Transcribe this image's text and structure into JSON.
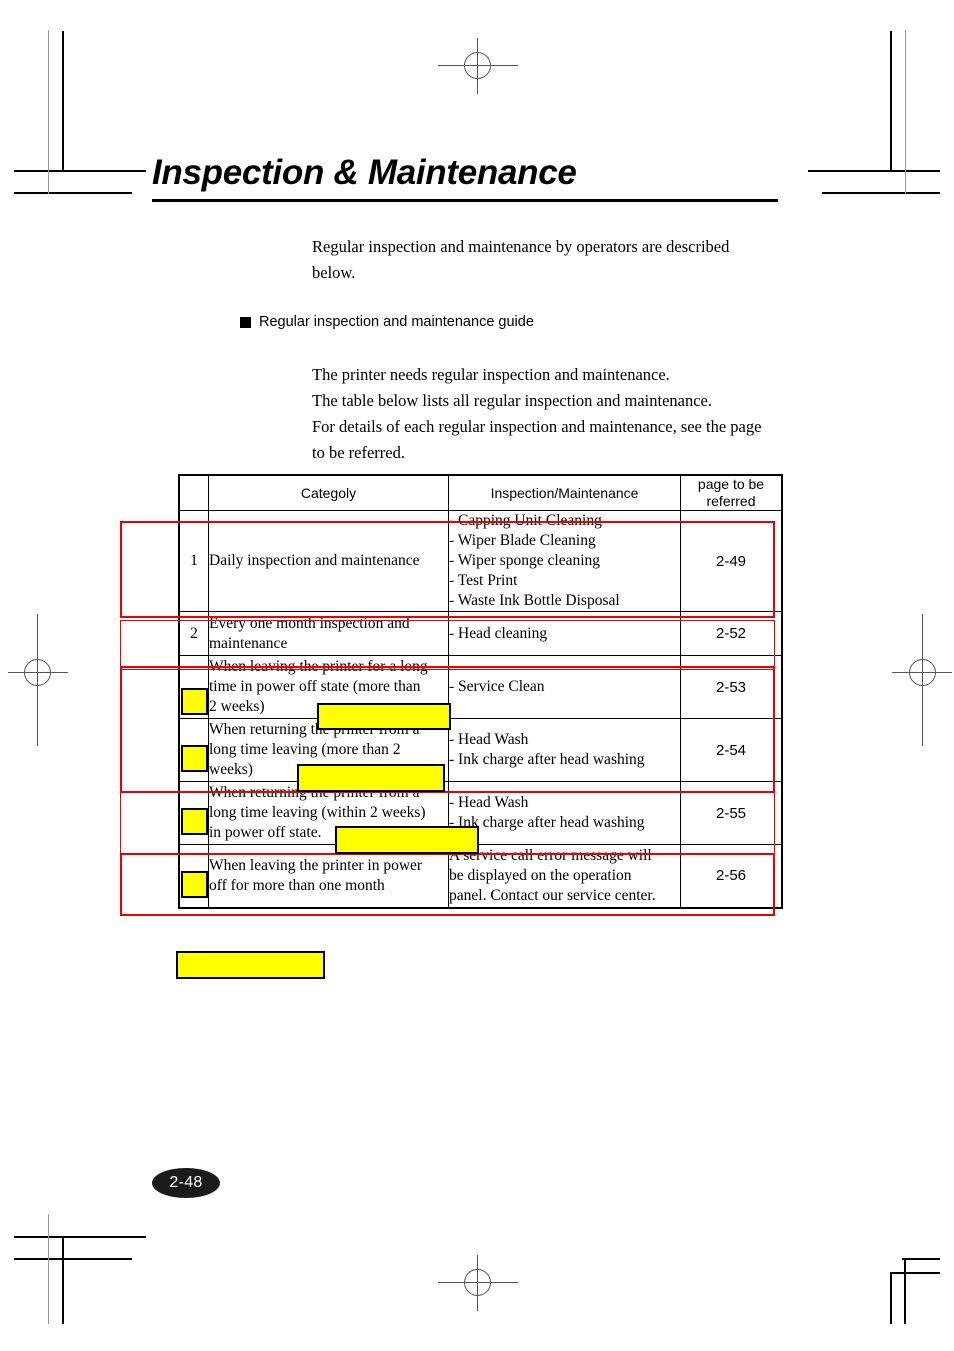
{
  "document": {
    "title": "Inspection & Maintenance",
    "page_number": "2-48"
  },
  "intro": {
    "line1": "Regular inspection and maintenance by operators are described",
    "line2": "below."
  },
  "section": {
    "bullet_heading": "Regular inspection and maintenance guide",
    "body": {
      "line1": "The printer needs regular inspection and maintenance.",
      "line2": "The table below lists all regular inspection and maintenance.",
      "line3": "For details of each regular inspection and maintenance, see the page",
      "line4": "to be referred."
    }
  },
  "table": {
    "headers": {
      "number": "",
      "category": "Categoly",
      "inspection": "Inspection/Maintenance",
      "page": "page to be referred",
      "page_line1": "page to be",
      "page_line2": "referred"
    },
    "rows": [
      {
        "number": "1",
        "category_lines": [
          "Daily inspection and maintenance"
        ],
        "inspection_lines": [
          "- Capping Unit Cleaning",
          "- Wiper Blade Cleaning",
          "- Wiper sponge cleaning",
          "- Test Print",
          "- Waste Ink Bottle Disposal"
        ],
        "page": "2-49"
      },
      {
        "number": "2",
        "category_lines": [
          "Every one month inspection and",
          "maintenance"
        ],
        "inspection_lines": [
          "- Head cleaning"
        ],
        "page": "2-52"
      },
      {
        "number": "",
        "category_lines": [
          "When leaving the printer for a long",
          "time in power off state (more than",
          "2 weeks)"
        ],
        "inspection_lines": [
          "- Service Clean"
        ],
        "page": "2-53"
      },
      {
        "number": "",
        "category_lines": [
          "When returning the printer from a",
          "long time leaving (more than 2",
          "weeks)"
        ],
        "inspection_lines": [
          "- Head Wash",
          "- Ink charge after head washing"
        ],
        "page": "2-54"
      },
      {
        "number": "",
        "category_lines": [
          "When returning the printer from a",
          "long time leaving (within 2 weeks)",
          "in power off state."
        ],
        "inspection_lines": [
          "- Head Wash",
          "- Ink charge after head washing"
        ],
        "page": "2-55"
      },
      {
        "number": "",
        "category_lines": [
          "When leaving the printer in power",
          "off for more than one month"
        ],
        "inspection_lines": [
          "A service call error message will",
          "be displayed on the operation",
          "panel.  Contact our service center."
        ],
        "page": "2-56"
      }
    ]
  },
  "annotations": {
    "highlight_color": "#ffff00",
    "redaction_border_color": "#000000",
    "redline_color": "#ee0000",
    "standalone_box_text": ""
  }
}
